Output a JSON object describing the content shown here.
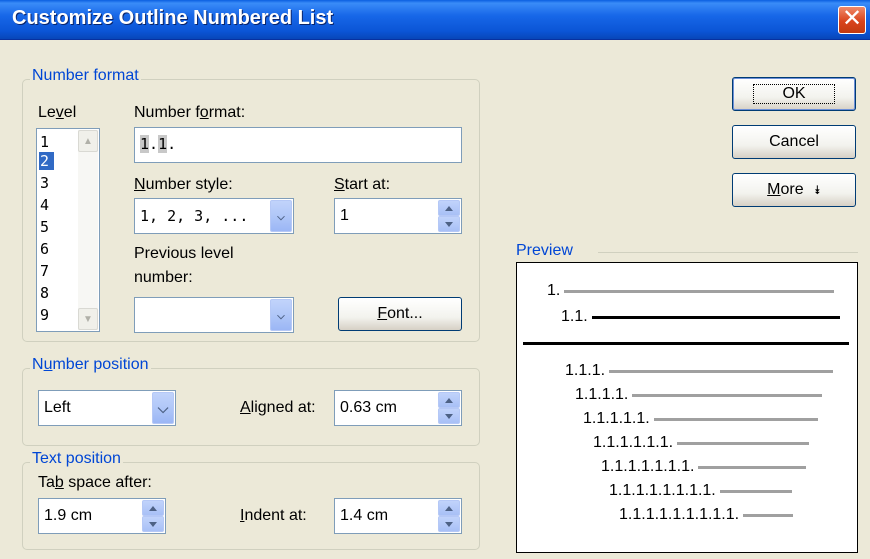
{
  "window": {
    "title": "Customize Outline Numbered List"
  },
  "number_format_group": {
    "legend": "Number format",
    "level_label": "Level",
    "levels": [
      "1",
      "2",
      "3",
      "4",
      "5",
      "6",
      "7",
      "8",
      "9"
    ],
    "selected_level": "2",
    "number_format_label": "Number format:",
    "number_format_value_highlighted": "1",
    "number_format_value_dot1": ".",
    "number_format_value_highlighted2": "1",
    "number_format_value_dot2": ".",
    "number_style_label": "Number style:",
    "number_style_value": "1, 2, 3, ...",
    "start_at_label": "Start at:",
    "start_at_value": "1",
    "previous_level_label_line1": "Previous level",
    "previous_level_label_line2": "number:",
    "previous_level_value": "",
    "font_button": "Font..."
  },
  "number_position_group": {
    "legend": "Number position",
    "alignment_value": "Left",
    "aligned_at_label": "Aligned at:",
    "aligned_at_value": "0.63 cm"
  },
  "text_position_group": {
    "legend": "Text position",
    "tab_space_label": "Tab space after:",
    "tab_space_value": "1.9 cm",
    "indent_at_label": "Indent at:",
    "indent_at_value": "1.4 cm"
  },
  "buttons": {
    "ok": "OK",
    "cancel": "Cancel",
    "more": "More",
    "more_glyph": "↓"
  },
  "preview": {
    "label": "Preview",
    "rows": [
      "1.",
      "1.1.",
      "",
      "1.1.1.",
      "1.1.1.1.",
      "1.1.1.1.1.",
      "1.1.1.1.1.1.",
      "1.1.1.1.1.1.1.",
      "1.1.1.1.1.1.1.1.",
      "1.1.1.1.1.1.1.1.1."
    ]
  },
  "colors": {
    "title_bar": "#0B55D6",
    "group_label": "#0046D5",
    "selection": "#316AC5",
    "dialog_bg": "#ECE9D8"
  }
}
